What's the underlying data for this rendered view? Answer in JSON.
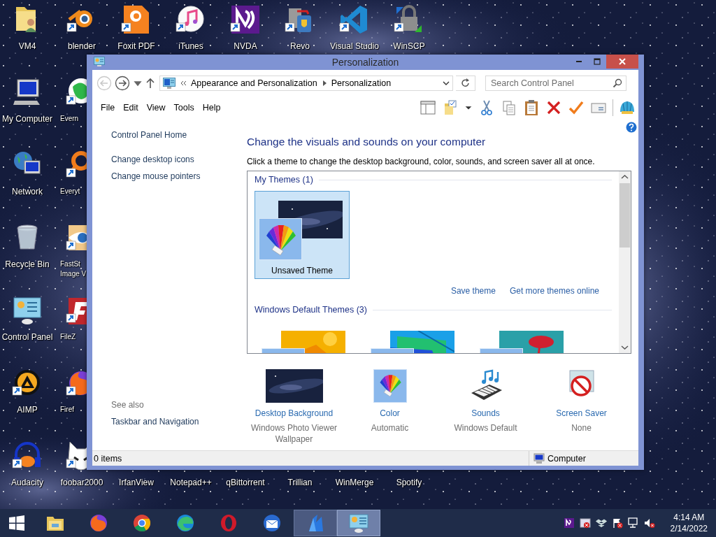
{
  "desktop": {
    "top_row": [
      {
        "label": "VM4",
        "kind": "folder",
        "shortcut": false
      },
      {
        "label": "blender",
        "kind": "blender",
        "shortcut": true
      },
      {
        "label": "Foxit PDF",
        "kind": "pdf",
        "shortcut": true
      },
      {
        "label": "iTunes",
        "kind": "itunes",
        "shortcut": true
      },
      {
        "label": "NVDA",
        "kind": "nvda",
        "shortcut": true
      },
      {
        "label": "Revo",
        "kind": "revo",
        "shortcut": true
      },
      {
        "label": "Visual Studio",
        "kind": "vscode",
        "shortcut": true
      },
      {
        "label": "WinSCP",
        "kind": "winscp",
        "shortcut": true
      }
    ],
    "first_column": [
      {
        "label": "My Computer",
        "kind": "computer",
        "shortcut": false
      },
      {
        "label": "Network",
        "kind": "network",
        "shortcut": false
      },
      {
        "label": "Recycle Bin",
        "kind": "recycle",
        "shortcut": false
      },
      {
        "label": "Control Panel",
        "kind": "controlpanel",
        "shortcut": false
      },
      {
        "label": "AIMP",
        "kind": "aimp",
        "shortcut": true
      }
    ],
    "second_column": [
      {
        "label": "Evern",
        "kind": "evernote",
        "shortcut": true
      },
      {
        "label": "Everyt",
        "kind": "everything",
        "shortcut": true
      },
      {
        "label": "FastSt Image V",
        "kind": "faststone",
        "shortcut": true
      },
      {
        "label": "FileZ",
        "kind": "filezilla",
        "shortcut": true
      },
      {
        "label": "Firef",
        "kind": "firefox",
        "shortcut": true
      }
    ],
    "bottom_row": [
      {
        "label": "Audacity",
        "kind": "audacity",
        "shortcut": true
      },
      {
        "label": "foobar2000",
        "kind": "foobar",
        "shortcut": true
      },
      {
        "label": "IrfanView",
        "kind": "covered"
      },
      {
        "label": "Notepad++",
        "kind": "covered"
      },
      {
        "label": "qBittorrent",
        "kind": "covered"
      },
      {
        "label": "Trillian",
        "kind": "covered"
      },
      {
        "label": "WinMerge",
        "kind": "covered"
      },
      {
        "label": "Spotify",
        "kind": "covered"
      }
    ]
  },
  "window": {
    "title": "Personalization",
    "back_disabled": true,
    "breadcrumbs": [
      "Appearance and Personalization",
      "Personalization"
    ],
    "search": {
      "placeholder": "Search Control Panel"
    },
    "menu": [
      "File",
      "Edit",
      "View",
      "Tools",
      "Help"
    ],
    "sidebar": {
      "links": [
        "Control Panel Home",
        "Change desktop icons",
        "Change mouse pointers"
      ],
      "see_also": {
        "heading": "See also",
        "links": [
          "Taskbar and Navigation"
        ]
      }
    },
    "main": {
      "heading": "Change the visuals and sounds on your computer",
      "description": "Click a theme to change the desktop background, color, sounds, and screen saver all at once.",
      "theme_groups": [
        {
          "title": "My Themes (1)",
          "themes": [
            {
              "name": "Unsaved Theme",
              "kind": "night",
              "selected": true
            }
          ],
          "links": [
            "Save theme",
            "Get more themes online"
          ]
        },
        {
          "title": "Windows Default Themes (3)",
          "themes": [
            {
              "kind": "sunrise",
              "selected": false
            },
            {
              "kind": "flow",
              "selected": false
            },
            {
              "kind": "flowers",
              "selected": false
            }
          ]
        }
      ],
      "settings": [
        {
          "title": "Desktop Background",
          "value": "Windows Photo Viewer Wallpaper",
          "kind": "background"
        },
        {
          "title": "Color",
          "value": "Automatic",
          "kind": "color"
        },
        {
          "title": "Sounds",
          "value": "Windows Default",
          "kind": "sounds"
        },
        {
          "title": "Screen Saver",
          "value": "None",
          "kind": "screensaver"
        }
      ]
    },
    "status_bar": {
      "items": "0 items",
      "location": "Computer"
    }
  },
  "taskbar": {
    "buttons": [
      {
        "kind": "start",
        "open": false,
        "active": false
      },
      {
        "kind": "explorer",
        "open": false,
        "active": false
      },
      {
        "kind": "firefox",
        "open": false,
        "active": false
      },
      {
        "kind": "chrome",
        "open": false,
        "active": false
      },
      {
        "kind": "edge",
        "open": false,
        "active": false
      },
      {
        "kind": "opera",
        "open": false,
        "active": false
      },
      {
        "kind": "mail",
        "open": false,
        "active": false
      },
      {
        "kind": "crystal",
        "open": true,
        "active": false
      },
      {
        "kind": "controlpanel",
        "open": true,
        "active": true
      }
    ],
    "clock": {
      "time": "4:14 AM",
      "date": "2/14/2022"
    }
  }
}
